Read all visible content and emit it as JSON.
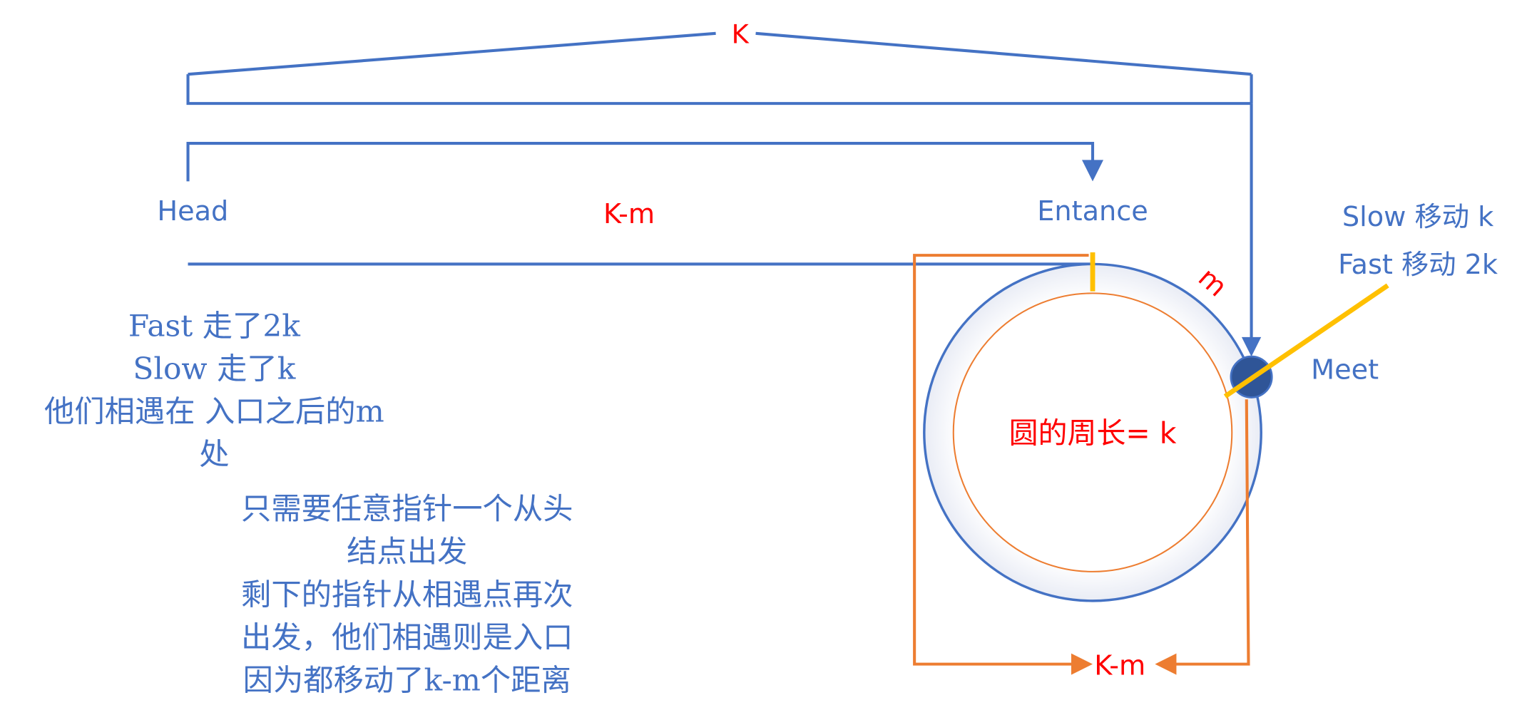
{
  "colors": {
    "blue": "#4472C4",
    "orange": "#ED7D31",
    "red": "#FF0000",
    "yellow": "#FFC000",
    "dot": "#2F5597",
    "text_blue": "#4472C4"
  },
  "labels": {
    "top_K": "K",
    "head": "Head",
    "k_minus_m_top": "K-m",
    "entrance": "Entance",
    "m": "m",
    "meet": "Meet",
    "slow_moves": "Slow 移动 k",
    "fast_moves": "Fast 移动 2k",
    "circumference": "圆的周长= k",
    "k_minus_m_bottom": "K-m"
  },
  "notes_left": [
    "Fast 走了2k",
    "Slow 走了k",
    "他们相遇在 入口之后的m",
    "处"
  ],
  "notes_bottom": [
    "只需要任意指针一个从头",
    "结点出发",
    "剩下的指针从相遇点再次",
    "出发，他们相遇则是入口",
    "因为都移动了k-m个距离"
  ]
}
